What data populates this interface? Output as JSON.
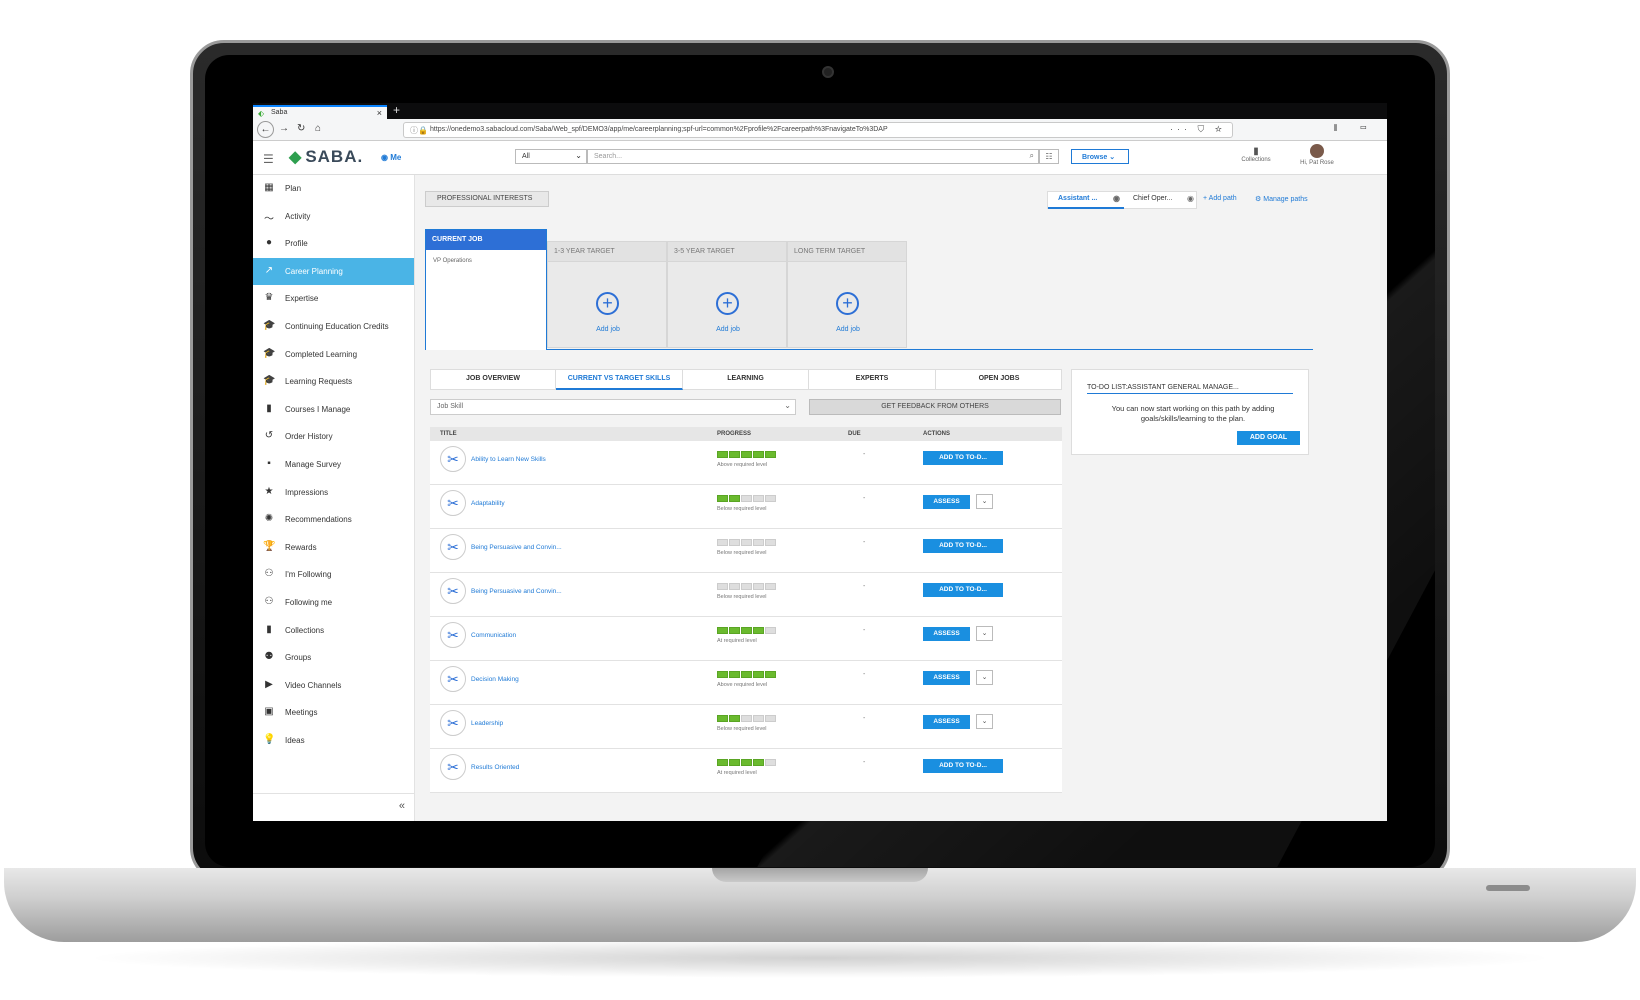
{
  "browser": {
    "tab_title": "Saba",
    "tab_close": "×",
    "new_tab": "+",
    "url": "https://onedemo3.sabacloud.com/Saba/Web_spf/DEMO3/app/me/careerplanning;spf-url=common%2Fprofile%2Fcareerpath%3FnavigateTo%3DAP",
    "url_actions": "··· ⛉ ☆",
    "nav_right": "⫴ ▭"
  },
  "header": {
    "logo_text": "SABA.",
    "me_label": "Me",
    "search_scope": "All",
    "search_placeholder": "Search...",
    "browse_label": "Browse",
    "collections_label": "Collections",
    "user_greeting": "Hi, Pat Rose"
  },
  "sidebar": {
    "active_index": 3,
    "items": [
      {
        "label": "Plan",
        "icon": "plan-icon",
        "glyph": "▦"
      },
      {
        "label": "Activity",
        "icon": "activity-icon",
        "glyph": "〜"
      },
      {
        "label": "Profile",
        "icon": "profile-icon",
        "glyph": "●"
      },
      {
        "label": "Career Planning",
        "icon": "career-planning-icon",
        "glyph": "↗"
      },
      {
        "label": "Expertise",
        "icon": "crown-icon",
        "glyph": "♛"
      },
      {
        "label": "Continuing Education Credits",
        "icon": "graduation-cap-icon",
        "glyph": "🎓"
      },
      {
        "label": "Completed Learning",
        "icon": "graduation-cap-check-icon",
        "glyph": "🎓"
      },
      {
        "label": "Learning Requests",
        "icon": "learning-requests-icon",
        "glyph": "🎓"
      },
      {
        "label": "Courses I Manage",
        "icon": "book-icon",
        "glyph": "▮"
      },
      {
        "label": "Order History",
        "icon": "history-icon",
        "glyph": "↺"
      },
      {
        "label": "Manage Survey",
        "icon": "survey-icon",
        "glyph": "▪"
      },
      {
        "label": "Impressions",
        "icon": "star-icon",
        "glyph": "★"
      },
      {
        "label": "Recommendations",
        "icon": "recommendations-icon",
        "glyph": "✺"
      },
      {
        "label": "Rewards",
        "icon": "trophy-icon",
        "glyph": "🏆"
      },
      {
        "label": "I'm Following",
        "icon": "following-icon",
        "glyph": "⚇"
      },
      {
        "label": "Following me",
        "icon": "followers-icon",
        "glyph": "⚇"
      },
      {
        "label": "Collections",
        "icon": "bookmark-icon",
        "glyph": "▮"
      },
      {
        "label": "Groups",
        "icon": "groups-icon",
        "glyph": "⚉"
      },
      {
        "label": "Video Channels",
        "icon": "video-icon",
        "glyph": "▶"
      },
      {
        "label": "Meetings",
        "icon": "calendar-icon",
        "glyph": "▣"
      },
      {
        "label": "Ideas",
        "icon": "lightbulb-icon",
        "glyph": "💡"
      }
    ],
    "collapse_label": "«"
  },
  "main": {
    "professional_interests": "PROFESSIONAL INTERESTS",
    "paths": [
      "Assistant ...",
      "Chief Oper..."
    ],
    "add_path": "+ Add path",
    "manage_paths": "Manage paths",
    "current_job": {
      "header": "CURRENT JOB",
      "title": "VP Operations"
    },
    "targets": [
      {
        "header": "1-3 YEAR TARGET",
        "action": "Add job"
      },
      {
        "header": "3-5 YEAR TARGET",
        "action": "Add job"
      },
      {
        "header": "LONG TERM TARGET",
        "action": "Add job"
      }
    ],
    "tabs": [
      "JOB OVERVIEW",
      "CURRENT VS TARGET SKILLS",
      "LEARNING",
      "EXPERTS",
      "OPEN JOBS"
    ],
    "active_tab": 1,
    "skill_filter": "Job Skill",
    "feedback_button": "GET FEEDBACK FROM OTHERS",
    "columns": [
      "TITLE",
      "PROGRESS",
      "DUE",
      "ACTIONS"
    ],
    "skills": [
      {
        "title": "Ability to Learn New Skills",
        "filled": 5,
        "status": "Above required level",
        "due": "-",
        "action": "ADD TO TO-D...",
        "dropdown": false
      },
      {
        "title": "Adaptability",
        "filled": 2,
        "status": "Below required level",
        "due": "-",
        "action": "ASSESS",
        "dropdown": true
      },
      {
        "title": "Being Persuasive and Convin...",
        "filled": 0,
        "status": "Below required level",
        "due": "-",
        "action": "ADD TO TO-D...",
        "dropdown": false
      },
      {
        "title": "Being Persuasive and Convin...",
        "filled": 0,
        "status": "Below required level",
        "due": "-",
        "action": "ADD TO TO-D...",
        "dropdown": false
      },
      {
        "title": "Communication",
        "filled": 4,
        "status": "At required level",
        "due": "-",
        "action": "ASSESS",
        "dropdown": true
      },
      {
        "title": "Decision Making",
        "filled": 5,
        "status": "Above required level",
        "due": "-",
        "action": "ASSESS",
        "dropdown": true
      },
      {
        "title": "Leadership",
        "filled": 2,
        "status": "Below required level",
        "due": "-",
        "action": "ASSESS",
        "dropdown": true
      },
      {
        "title": "Results Oriented",
        "filled": 4,
        "status": "At required level",
        "due": "-",
        "action": "ADD TO TO-D...",
        "dropdown": false
      }
    ],
    "todo": {
      "title": "TO-DO LIST:ASSISTANT GENERAL MANAGE...",
      "message": "You can now start working on this path by adding goals/skills/learning to the plan.",
      "button": "ADD GOAL"
    }
  },
  "colors": {
    "accent": "#1f7ad6",
    "active_nav": "#4ab4e6",
    "progress_on": "#6aba2e"
  }
}
